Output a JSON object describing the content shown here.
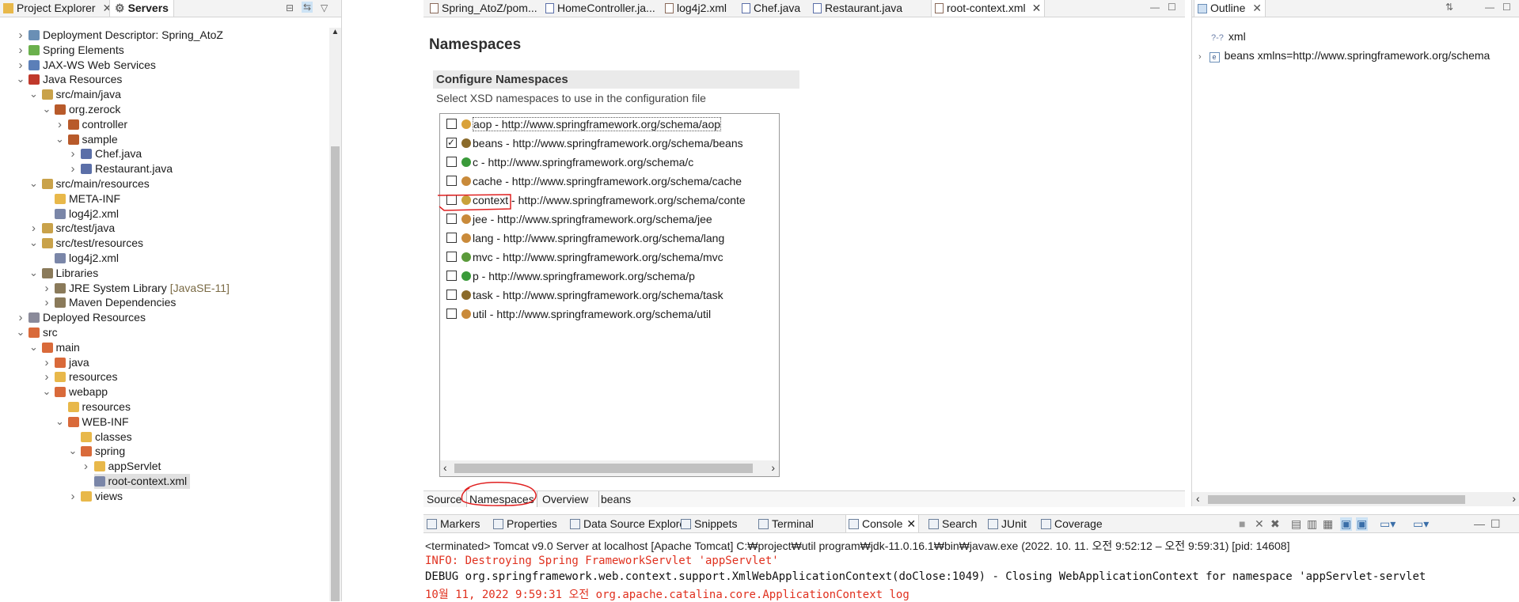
{
  "left_panel": {
    "tabs": [
      {
        "label": "Project Explorer",
        "active": false
      },
      {
        "label": "Servers",
        "active": true
      }
    ],
    "tree": [
      {
        "label": "Deployment Descriptor: Spring_AtoZ",
        "level": 1,
        "arrow": "›",
        "icon": "deployment-descriptor"
      },
      {
        "label": "Spring Elements",
        "level": 1,
        "arrow": "›",
        "icon": "spring-elements"
      },
      {
        "label": "JAX-WS Web Services",
        "level": 1,
        "arrow": "›",
        "icon": "web-services"
      },
      {
        "label": "Java Resources",
        "level": 1,
        "arrow": "⌄",
        "icon": "java-resources"
      },
      {
        "label": "src/main/java",
        "level": 2,
        "arrow": "⌄",
        "icon": "source-folder"
      },
      {
        "label": "org.zerock",
        "level": 3,
        "arrow": "⌄",
        "icon": "package"
      },
      {
        "label": "controller",
        "level": 4,
        "arrow": "›",
        "icon": "package"
      },
      {
        "label": "sample",
        "level": 4,
        "arrow": "⌄",
        "icon": "package"
      },
      {
        "label": "Chef.java",
        "level": 5,
        "arrow": "›",
        "icon": "java-file"
      },
      {
        "label": "Restaurant.java",
        "level": 5,
        "arrow": "›",
        "icon": "java-file"
      },
      {
        "label": "src/main/resources",
        "level": 2,
        "arrow": "⌄",
        "icon": "source-folder"
      },
      {
        "label": "META-INF",
        "level": 3,
        "arrow": "",
        "icon": "folder"
      },
      {
        "label": "log4j2.xml",
        "level": 3,
        "arrow": "",
        "icon": "xml-file"
      },
      {
        "label": "src/test/java",
        "level": 2,
        "arrow": "›",
        "icon": "source-folder"
      },
      {
        "label": "src/test/resources",
        "level": 2,
        "arrow": "⌄",
        "icon": "source-folder"
      },
      {
        "label": "log4j2.xml",
        "level": 3,
        "arrow": "",
        "icon": "xml-file"
      },
      {
        "label": "Libraries",
        "level": 2,
        "arrow": "⌄",
        "icon": "libraries"
      },
      {
        "label": "JRE System Library",
        "suffix": "[JavaSE-11]",
        "level": 3,
        "arrow": "›",
        "icon": "library"
      },
      {
        "label": "Maven Dependencies",
        "level": 3,
        "arrow": "›",
        "icon": "library"
      },
      {
        "label": "Deployed Resources",
        "level": 1,
        "arrow": "›",
        "icon": "deployed-resources"
      },
      {
        "label": "src",
        "level": 1,
        "arrow": "⌄",
        "icon": "folder-src"
      },
      {
        "label": "main",
        "level": 2,
        "arrow": "⌄",
        "icon": "folder-src"
      },
      {
        "label": "java",
        "level": 3,
        "arrow": "›",
        "icon": "folder-src"
      },
      {
        "label": "resources",
        "level": 3,
        "arrow": "›",
        "icon": "folder"
      },
      {
        "label": "webapp",
        "level": 3,
        "arrow": "⌄",
        "icon": "folder-src"
      },
      {
        "label": "resources",
        "level": 4,
        "arrow": "",
        "icon": "folder"
      },
      {
        "label": "WEB-INF",
        "level": 4,
        "arrow": "⌄",
        "icon": "folder-src"
      },
      {
        "label": "classes",
        "level": 5,
        "arrow": "",
        "icon": "folder"
      },
      {
        "label": "spring",
        "level": 5,
        "arrow": "⌄",
        "icon": "folder-src"
      },
      {
        "label": "appServlet",
        "level": 6,
        "arrow": "›",
        "icon": "folder"
      },
      {
        "label": "root-context.xml",
        "level": 6,
        "arrow": "",
        "icon": "xml-file",
        "selected": true
      },
      {
        "label": "views",
        "level": 5,
        "arrow": "›",
        "icon": "folder"
      }
    ]
  },
  "editor": {
    "tabs": [
      {
        "label": "Spring_AtoZ/pom...",
        "icon": "pom-file"
      },
      {
        "label": "HomeController.ja...",
        "icon": "java-file"
      },
      {
        "label": "log4j2.xml",
        "icon": "xml-file"
      },
      {
        "label": "Chef.java",
        "icon": "java-file"
      },
      {
        "label": "Restaurant.java",
        "icon": "java-file"
      },
      {
        "label": "root-context.xml",
        "icon": "xml-file",
        "active": true
      }
    ],
    "heading": "Namespaces",
    "section_title": "Configure Namespaces",
    "section_desc": "Select XSD namespaces to use in the configuration file",
    "namespaces": [
      {
        "label": "aop - http://www.springframework.org/schema/aop",
        "checked": false,
        "color": "#d9a23a"
      },
      {
        "label": "beans - http://www.springframework.org/schema/beans",
        "checked": true,
        "color": "#8a6a2a"
      },
      {
        "label": "c - http://www.springframework.org/schema/c",
        "checked": false,
        "color": "#3a9a3a"
      },
      {
        "label": "cache - http://www.springframework.org/schema/cache",
        "checked": false,
        "color": "#c98a3a"
      },
      {
        "label": "context - http://www.springframework.org/schema/conte",
        "checked": false,
        "color": "#c9a23a",
        "highlight": "context"
      },
      {
        "label": "jee - http://www.springframework.org/schema/jee",
        "checked": false,
        "color": "#c98a3a"
      },
      {
        "label": "lang - http://www.springframework.org/schema/lang",
        "checked": false,
        "color": "#c98a3a"
      },
      {
        "label": "mvc - http://www.springframework.org/schema/mvc",
        "checked": false,
        "color": "#5a9a3a"
      },
      {
        "label": "p - http://www.springframework.org/schema/p",
        "checked": false,
        "color": "#3a9a3a"
      },
      {
        "label": "task - http://www.springframework.org/schema/task",
        "checked": false,
        "color": "#8a6a2a"
      },
      {
        "label": "util - http://www.springframework.org/schema/util",
        "checked": false,
        "color": "#c98a3a"
      }
    ],
    "bottom_tabs": [
      "Source",
      "Namespaces",
      "Overview",
      "beans"
    ]
  },
  "outline": {
    "tab": "Outline",
    "items": [
      {
        "label": "xml",
        "icon_text": "?-?"
      },
      {
        "label": "beans xmlns=http://www.springframework.org/schema",
        "icon_text": "e"
      }
    ]
  },
  "console": {
    "tabs": [
      "Markers",
      "Properties",
      "Data Source Explorer",
      "Snippets",
      "Terminal",
      "Console",
      "Search",
      "JUnit",
      "Coverage"
    ],
    "active_tab": "Console",
    "header": "<terminated> Tomcat v9.0 Server at localhost [Apache Tomcat] C:₩project₩util program₩jdk-11.0.16.1₩bin₩javaw.exe  (2022. 10. 11. 오전 9:52:12 – 오전 9:59:31) [pid: 14608]",
    "lines": [
      {
        "text": "INFO: Destroying Spring FrameworkServlet 'appServlet'",
        "color": "#e0301e"
      },
      {
        "text": " DEBUG org.springframework.web.context.support.XmlWebApplicationContext(doClose:1049) - Closing WebApplicationContext for namespace 'appServlet-servlet",
        "color": "#111111"
      },
      {
        "text": "10월 11, 2022 9:59:31 오전 org.apache.catalina.core.ApplicationContext log",
        "color": "#e0301e"
      }
    ]
  },
  "colors": {
    "annotation": "#e02020",
    "tab_bar": "#f3f3f3",
    "selection": "#e0e0e0"
  }
}
